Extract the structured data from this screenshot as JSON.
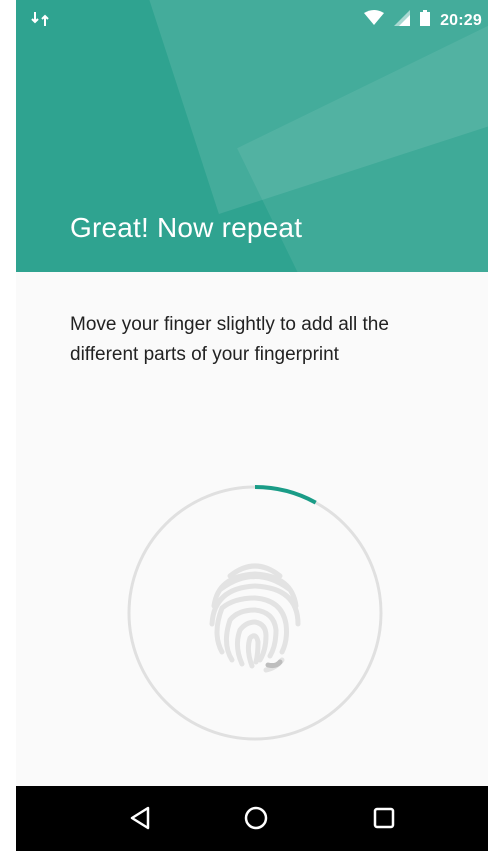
{
  "status_bar": {
    "time": "20:29",
    "icons": [
      "sync-icon",
      "wifi-icon",
      "cell-signal-icon",
      "battery-icon"
    ]
  },
  "header": {
    "title": "Great! Now repeat",
    "color": "#2fa390"
  },
  "content": {
    "instructions": "Move your finger slightly to add all the different parts of your fingerprint"
  },
  "fingerprint": {
    "icon": "fingerprint-icon",
    "progress_fraction": 0.08,
    "progress_color": "#1a9c87",
    "ring_color": "#e0e0e0"
  },
  "nav_bar": {
    "buttons": [
      "back-icon",
      "home-icon",
      "recents-icon"
    ]
  }
}
